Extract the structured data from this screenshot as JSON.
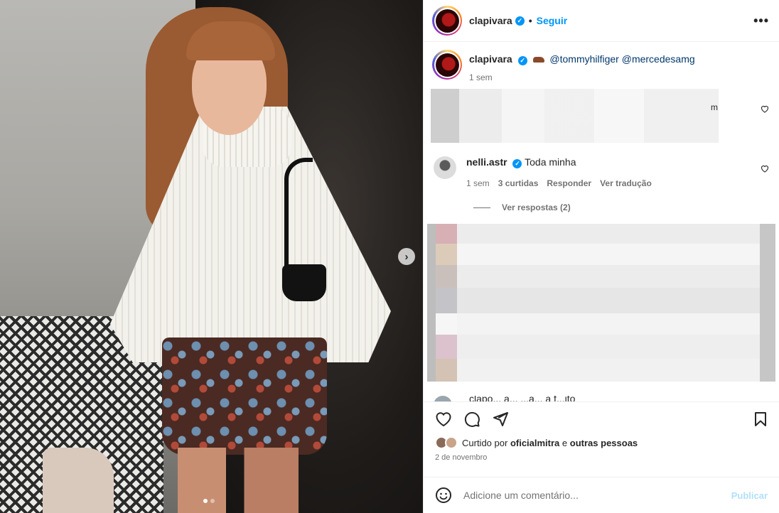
{
  "post": {
    "username": "clapivara",
    "verified_mark": "✓",
    "separator": "•",
    "follow_label": "Seguir",
    "more_label": "•••"
  },
  "caption": {
    "username": "clapivara",
    "mentions": "@tommyhilfiger @mercedesamg",
    "time": "1 sem"
  },
  "blurred_comment": {
    "tail": "m"
  },
  "comment": {
    "username": "nelli.astr",
    "text": "Toda minha",
    "time": "1 sem",
    "likes": "3 curtidas",
    "reply_label": "Responder",
    "translate_label": "Ver tradução",
    "view_replies": "Ver respostas (2)"
  },
  "partial_comment": {
    "text": "clapo... a... ...a... a f...ito"
  },
  "carousel": {
    "next_label": "›",
    "count": 2,
    "active_index": 0
  },
  "likes": {
    "prefix": "Curtido por",
    "user": "oficialmitra",
    "conj": "e",
    "rest": "outras pessoas"
  },
  "date": "2 de novembro",
  "add_comment": {
    "placeholder": "Adicione um comentário...",
    "publish_label": "Publicar"
  },
  "colors": {
    "link": "#0095f6",
    "mention": "#00376b",
    "muted": "#737373",
    "publish_disabled": "#b2dffc"
  }
}
